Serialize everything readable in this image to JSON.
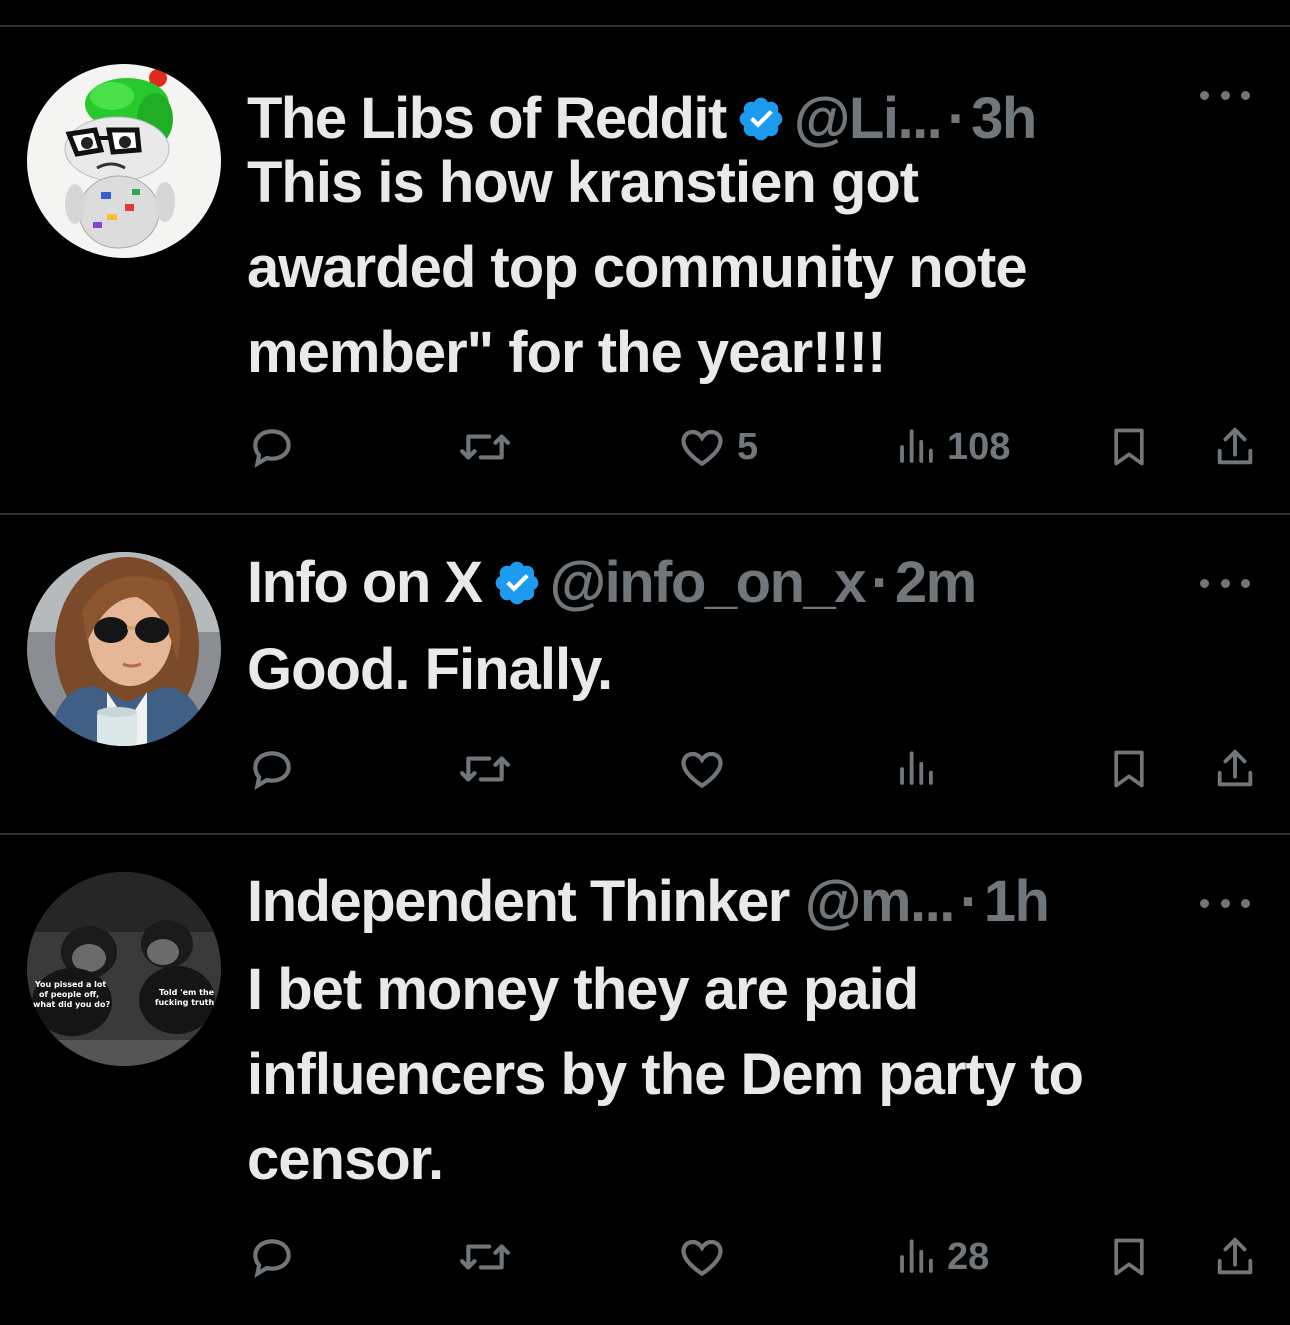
{
  "colors": {
    "background": "#000000",
    "text": "#e7e9ea",
    "secondary": "#71767b",
    "divider": "#2f3336",
    "verified": "#1d9bf0"
  },
  "tweets": [
    {
      "name": "The Libs of Reddit",
      "verified": true,
      "handle": "@Li...",
      "dot": "·",
      "time": "3h",
      "lines": [
        "This is how kranstien got",
        "awarded top community note",
        "member\" for the year!!!!"
      ],
      "avatar": "reddit-alien-green-hair-avatar",
      "counts": {
        "reply": "",
        "retweet": "",
        "like": "5",
        "views": "108"
      }
    },
    {
      "name": "Info on X",
      "verified": true,
      "handle": "@info_on_x",
      "dot": "·",
      "time": "2m",
      "lines": [
        "Good. Finally."
      ],
      "avatar": "woman-sunglasses-avatar",
      "counts": {
        "reply": "",
        "retweet": "",
        "like": "",
        "views": ""
      }
    },
    {
      "name": "Independent Thinker",
      "verified": false,
      "handle": "@m...",
      "dot": "·",
      "time": "1h",
      "lines": [
        "I bet money they are paid",
        "influencers by the Dem party to",
        "censor."
      ],
      "avatar": "chimpanzees-meme-avatar",
      "avatar_text": {
        "left": [
          "You pissed a lot",
          "of people off,",
          "what did you do?"
        ],
        "right": [
          "Told 'em the",
          "fucking truth"
        ]
      },
      "counts": {
        "reply": "",
        "retweet": "",
        "like": "",
        "views": "28"
      }
    }
  ]
}
